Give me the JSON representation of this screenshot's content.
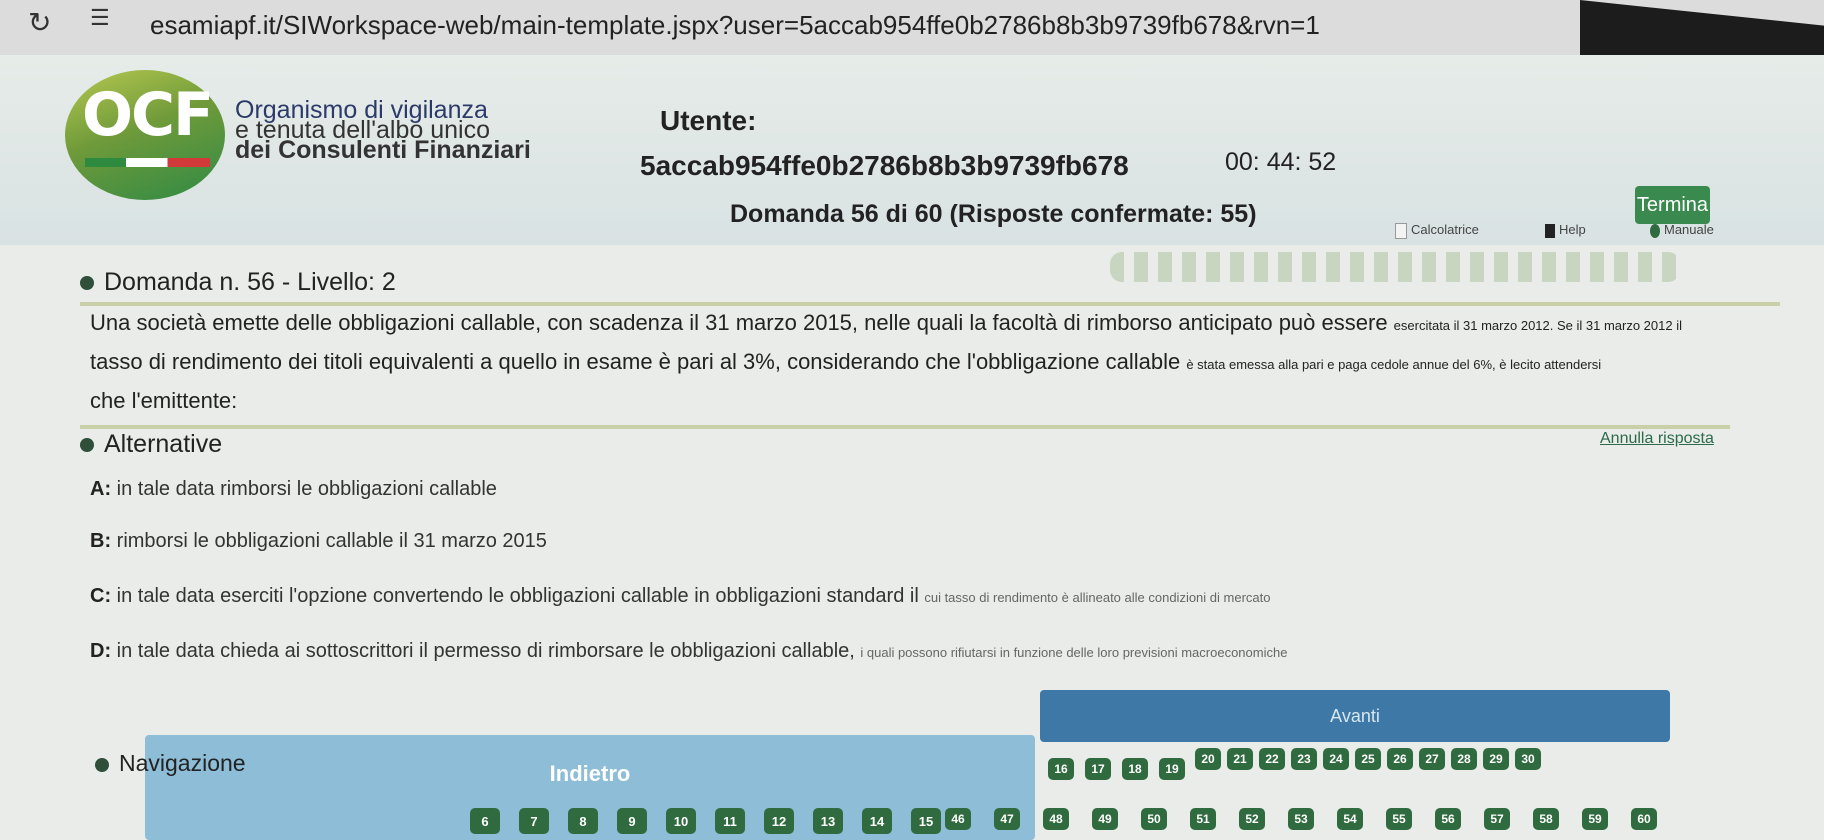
{
  "browser": {
    "reload_icon": "reload-icon",
    "site_icon": "site-settings-icon",
    "url": "esamiapf.it/SIWorkspace-web/main-template.jspx?user=5accab954ffe0b2786b8b3b9739fb678&rvn=1"
  },
  "header": {
    "logo_text": "OCF",
    "org_line1": "Organismo di vigilanza",
    "org_line2": "e tenuta dell'albo unico",
    "org_line3": "dei Consulenti Finanziari",
    "user_label": "Utente:",
    "user_id": "5accab954ffe0b2786b8b3b9739fb678",
    "timer": "00: 44: 52",
    "termina": "Termina",
    "question_counter": "Domanda 56 di 60 (Risposte confermate: 55)",
    "tools": {
      "calc": "Calcolatrice",
      "help": "Help",
      "manual": "Manuale"
    }
  },
  "question": {
    "heading": "Domanda n. 56 - Livello: 2",
    "text_line1": "Una società emette delle obbligazioni callable, con scadenza il 31 marzo 2015, nelle quali la facoltà di rimborso anticipato può essere ",
    "text_line1_small": "esercitata il 31 marzo 2012. Se il 31 marzo 2012 il",
    "text_line2": "tasso di rendimento dei titoli equivalenti a quello in esame è pari al 3%, considerando che l'obbligazione callable ",
    "text_line2_small": "è stata emessa alla pari e paga cedole annue del 6%, è lecito attendersi",
    "text_line3": "che l'emittente:"
  },
  "alternatives": {
    "heading": "Alternative",
    "annulla": "Annulla risposta",
    "items": [
      {
        "key": "A:",
        "text": "in tale data rimborsi le obbligazioni callable",
        "small": ""
      },
      {
        "key": "B:",
        "text": "rimborsi le obbligazioni callable il 31 marzo 2015",
        "small": ""
      },
      {
        "key": "C:",
        "text": "in tale data eserciti l'opzione convertendo le obbligazioni callable in obbligazioni standard il ",
        "small": "cui tasso di rendimento è allineato alle condizioni di mercato"
      },
      {
        "key": "D:",
        "text": "in tale data chieda ai sottoscrittori il permesso di rimborsare le obbligazioni callable, ",
        "small": "i quali possono rifiutarsi in funzione delle loro previsioni macroeconomiche"
      }
    ]
  },
  "navigation": {
    "heading": "Navigazione",
    "avanti": "Avanti",
    "indietro": "Indietro",
    "row1": [
      "20",
      "21",
      "22",
      "23",
      "24",
      "25",
      "26",
      "27",
      "28",
      "29",
      "30"
    ],
    "row1_prefix": [
      "16",
      "17",
      "18",
      "19"
    ],
    "row2": [
      "6",
      "7",
      "8",
      "9",
      "10",
      "11",
      "12",
      "13",
      "14",
      "15"
    ],
    "row3": [
      "46",
      "47",
      "48",
      "49",
      "50",
      "51",
      "52",
      "53",
      "54",
      "55",
      "56",
      "57",
      "58",
      "59",
      "60"
    ]
  }
}
